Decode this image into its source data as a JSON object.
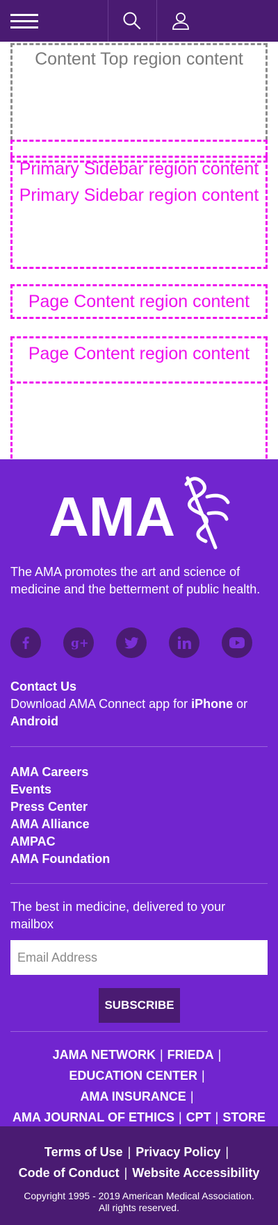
{
  "header": {
    "menu_icon": "hamburger-menu-icon",
    "search_icon": "search-icon",
    "account_icon": "user-account-icon",
    "background_color": "#4a1b72"
  },
  "regions": {
    "content_top": "Content Top region content",
    "primary_sidebar_1": "Primary Sidebar region content",
    "primary_sidebar_2": "Primary Sidebar region content",
    "page_content_1": "Page Content region content",
    "page_content_2": "Page Content region content"
  },
  "footer": {
    "background_color": "#7125cf",
    "logo_text": "AMA",
    "tagline": "The AMA promotes the art and science of medicine and the betterment of public health.",
    "social": [
      {
        "name": "facebook-icon",
        "glyph": "f"
      },
      {
        "name": "google-plus-icon",
        "glyph": "g+"
      },
      {
        "name": "twitter-icon",
        "glyph": "twitter"
      },
      {
        "name": "linkedin-icon",
        "glyph": "in"
      },
      {
        "name": "youtube-icon",
        "glyph": "play"
      }
    ],
    "contact_label": "Contact Us",
    "download_prefix": "Download AMA Connect app for ",
    "iphone_label": "iPhone",
    "or_label": " or ",
    "android_label": "Android",
    "links": [
      "AMA Careers",
      "Events",
      "Press Center",
      "AMA Alliance",
      "AMPAC",
      "AMA Foundation"
    ],
    "newsletter_text": "The best in medicine, delivered to your mailbox",
    "email_placeholder": "Email Address",
    "subscribe_label": "SUBSCRIBE",
    "partners": [
      "JAMA NETWORK",
      "FRIEDA",
      "EDUCATION CENTER",
      "AMA INSURANCE",
      "AMA JOURNAL OF ETHICS",
      "CPT",
      "STORE"
    ]
  },
  "bottom": {
    "background_color": "#4a1b72",
    "legal_links": [
      "Terms of Use",
      "Privacy Policy",
      "Code of Conduct",
      "Website Accessibility"
    ],
    "copyright_line1": "Copyright 1995 - 2019 American Medical Association.",
    "copyright_line2": "All rights reserved."
  }
}
